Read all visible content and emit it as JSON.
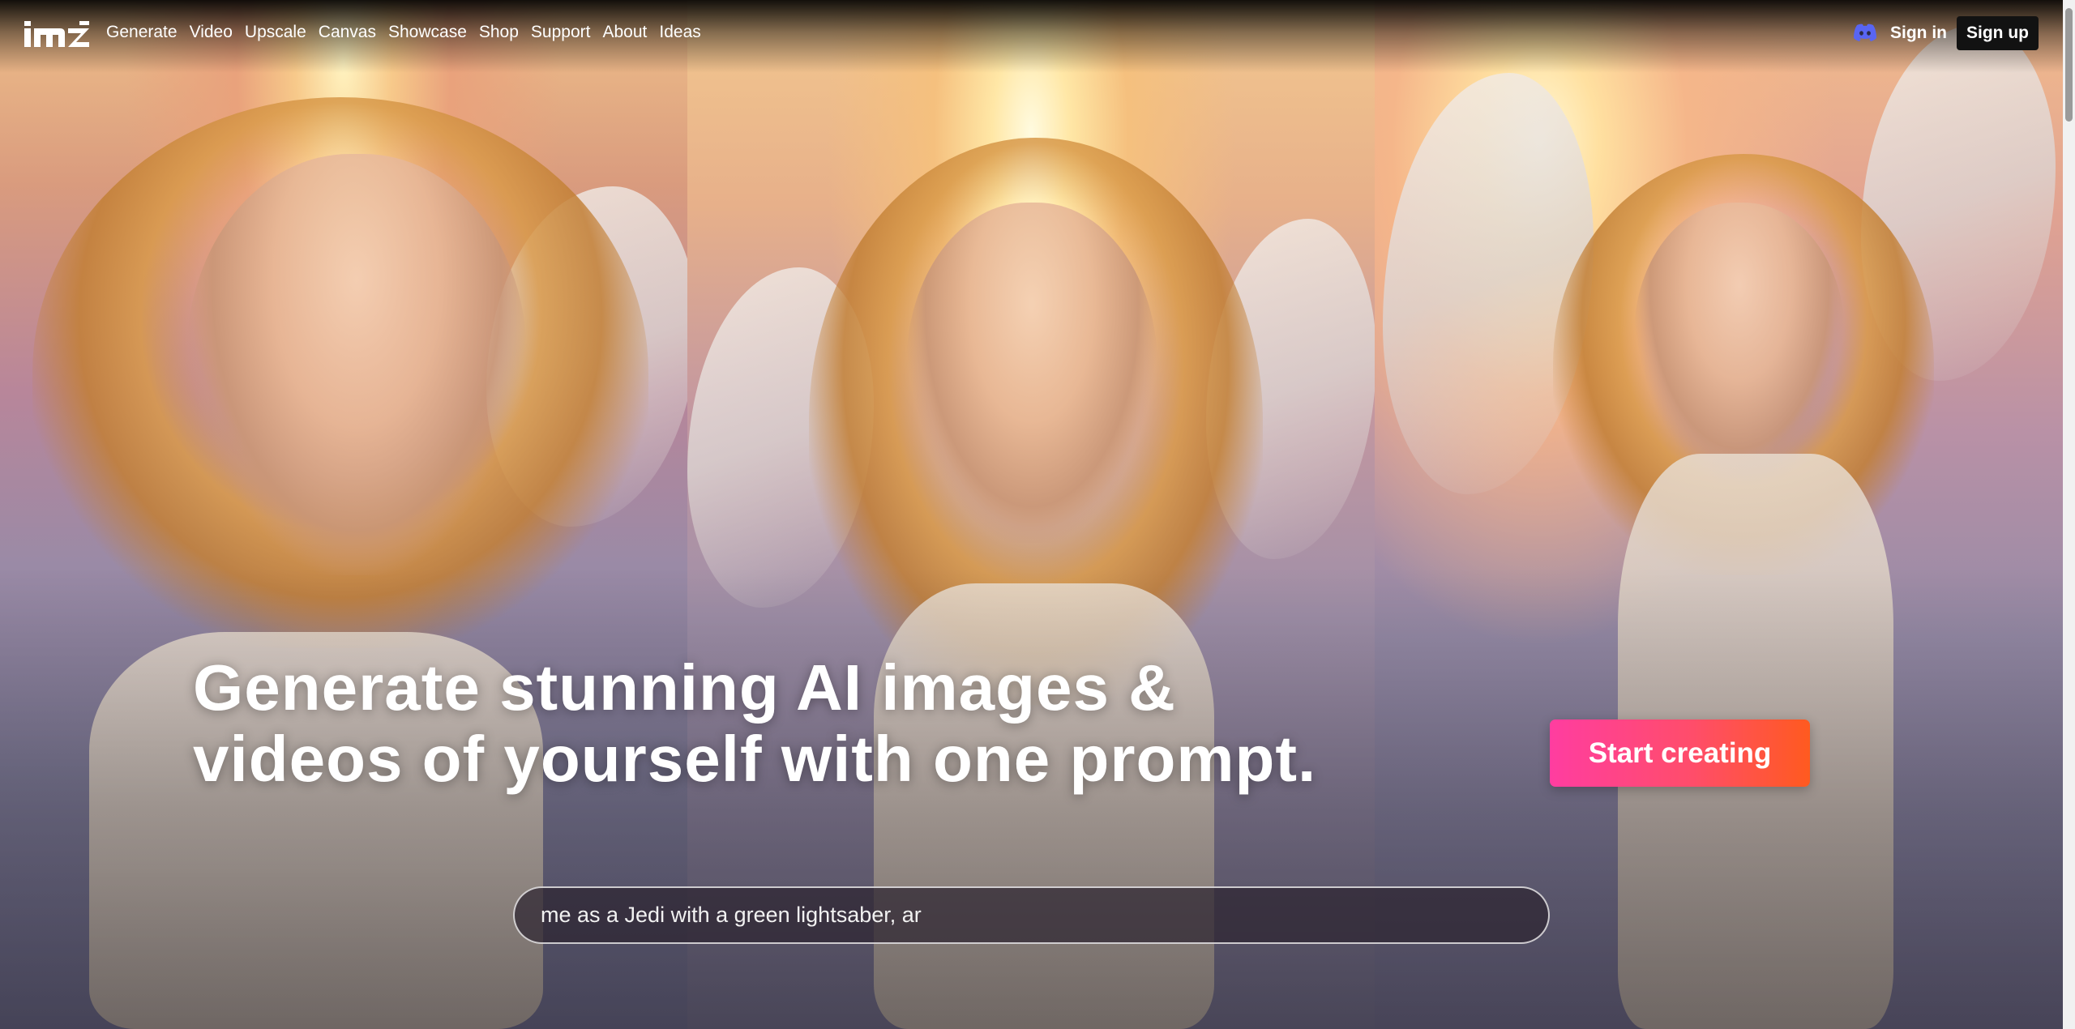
{
  "brand": {
    "logo_text": "im",
    "logo_icon": "mz-logo"
  },
  "nav": {
    "links": [
      {
        "label": "Generate"
      },
      {
        "label": "Video"
      },
      {
        "label": "Upscale"
      },
      {
        "label": "Canvas"
      },
      {
        "label": "Showcase"
      },
      {
        "label": "Shop"
      },
      {
        "label": "Support"
      },
      {
        "label": "About"
      },
      {
        "label": "Ideas"
      }
    ],
    "discord_icon": "discord-icon",
    "sign_in_label": "Sign in",
    "sign_up_label": "Sign up"
  },
  "hero": {
    "headline_line1": "Generate stunning AI images &",
    "headline_line2": "videos of yourself with one prompt.",
    "cta_label": "Start creating",
    "prompt_value": "me as a Jedi with a green lightsaber, ar"
  },
  "colors": {
    "cta_gradient_start": "#ff3da0",
    "cta_gradient_end": "#ff5a1f",
    "signup_bg": "#121212",
    "discord_blue": "#5865F2"
  }
}
